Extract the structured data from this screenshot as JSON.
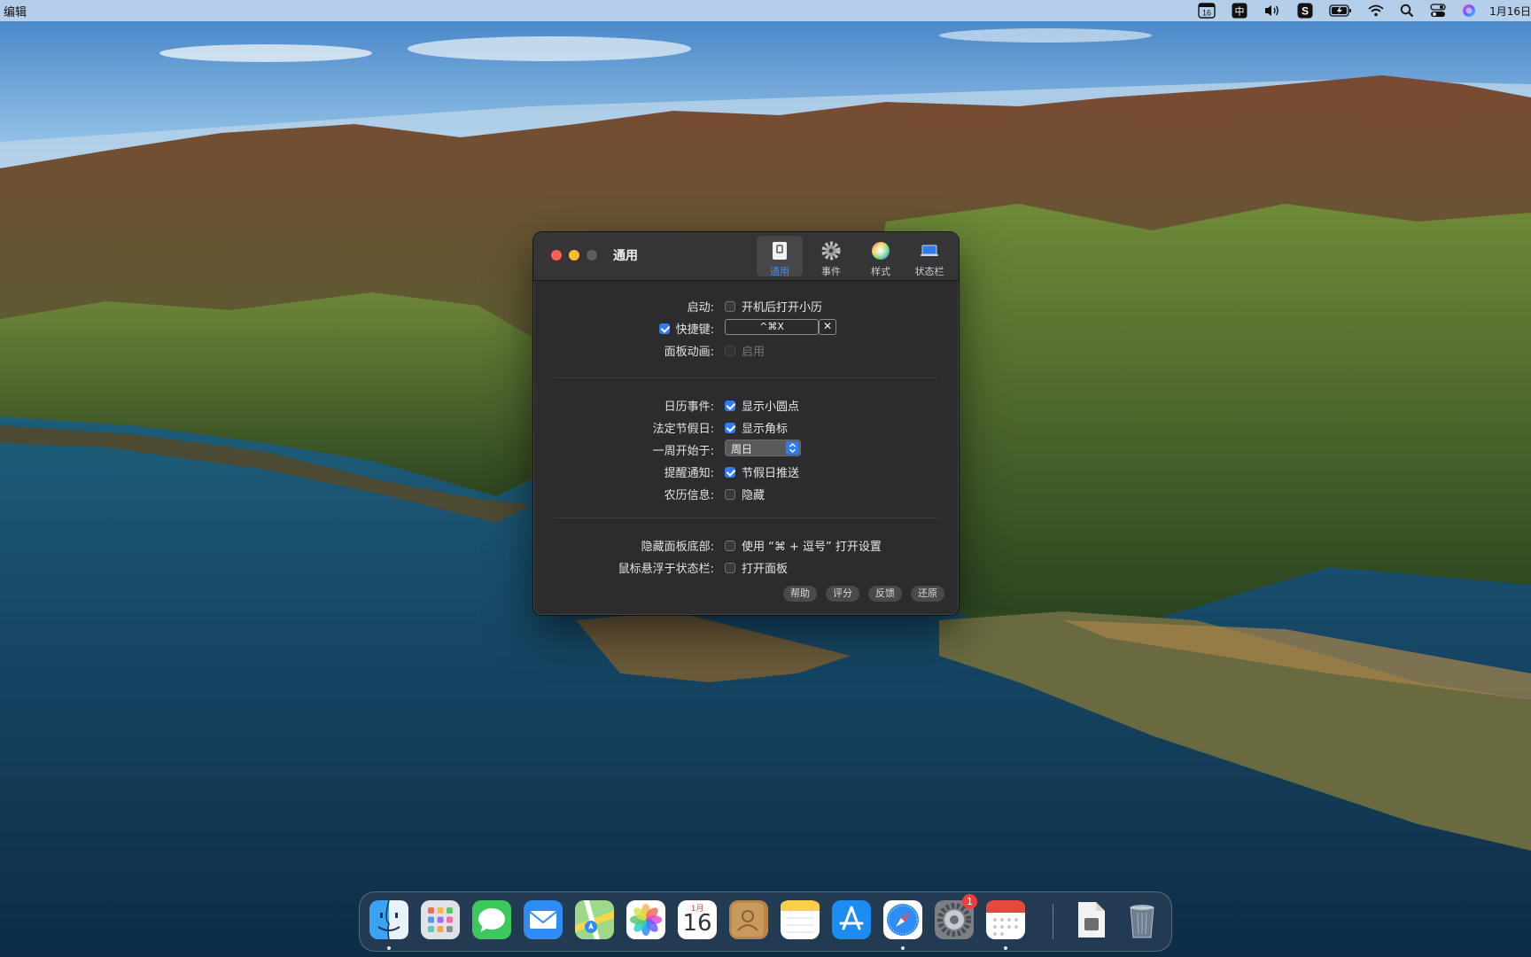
{
  "menubar": {
    "app_menu": "编辑",
    "status_icons": [
      "calendar-badge-icon",
      "input-method-icon",
      "volume-icon",
      "s-app-icon",
      "battery-icon",
      "wifi-icon",
      "search-icon",
      "control-center-icon",
      "siri-icon"
    ],
    "calendar_badge": "16",
    "input_method": "中",
    "s_app": "S",
    "date": "1月16日"
  },
  "window": {
    "title": "通用",
    "toolbar": {
      "tabs": [
        {
          "label": "通用",
          "icon": "general-icon",
          "active": true
        },
        {
          "label": "事件",
          "icon": "gear-icon",
          "active": false
        },
        {
          "label": "样式",
          "icon": "color-wheel-icon",
          "active": false
        },
        {
          "label": "状态栏",
          "icon": "laptop-icon",
          "active": false
        }
      ]
    },
    "settings": {
      "launch": {
        "label": "启动:",
        "option": "开机后打开小历",
        "checked": false
      },
      "shortcut": {
        "label": "快捷键:",
        "checked": true,
        "value": "^⌘X",
        "clear": "✕"
      },
      "panel_animation": {
        "label": "面板动画:",
        "option": "启用",
        "checked": false,
        "disabled": true
      },
      "calendar_events": {
        "label": "日历事件:",
        "option": "显示小圆点",
        "checked": true
      },
      "holidays": {
        "label": "法定节假日:",
        "option": "显示角标",
        "checked": true
      },
      "week_start": {
        "label": "一周开始于:",
        "value": "周日"
      },
      "reminders": {
        "label": "提醒通知:",
        "option": "节假日推送",
        "checked": true
      },
      "lunar": {
        "label": "农历信息:",
        "option": "隐藏",
        "checked": false
      },
      "hide_panel_bottom": {
        "label": "隐藏面板底部:",
        "option": "使用 “⌘ + 逗号” 打开设置",
        "checked": false
      },
      "hover_statusbar": {
        "label": "鼠标悬浮于状态栏:",
        "option": "打开面板",
        "checked": false
      }
    },
    "footer": {
      "help": "帮助",
      "rate": "评分",
      "feedback": "反馈",
      "restore": "还原"
    }
  },
  "dock": {
    "apps": [
      "finder-icon",
      "launchpad-icon",
      "messages-icon",
      "mail-icon",
      "maps-icon",
      "photos-icon",
      "calendar-icon",
      "contacts-icon",
      "notes-icon",
      "app-store-icon",
      "safari-icon",
      "system-settings-icon",
      "xiaoli-calendar-icon",
      "document-icon",
      "trash-icon"
    ],
    "calendar_month": "1月",
    "calendar_day": "16",
    "settings_badge": "1"
  },
  "colors": {
    "accent": "#2f7cf6",
    "window_bg": "#2c2c2e",
    "close": "#ff5f57",
    "minimize": "#febc2e"
  }
}
